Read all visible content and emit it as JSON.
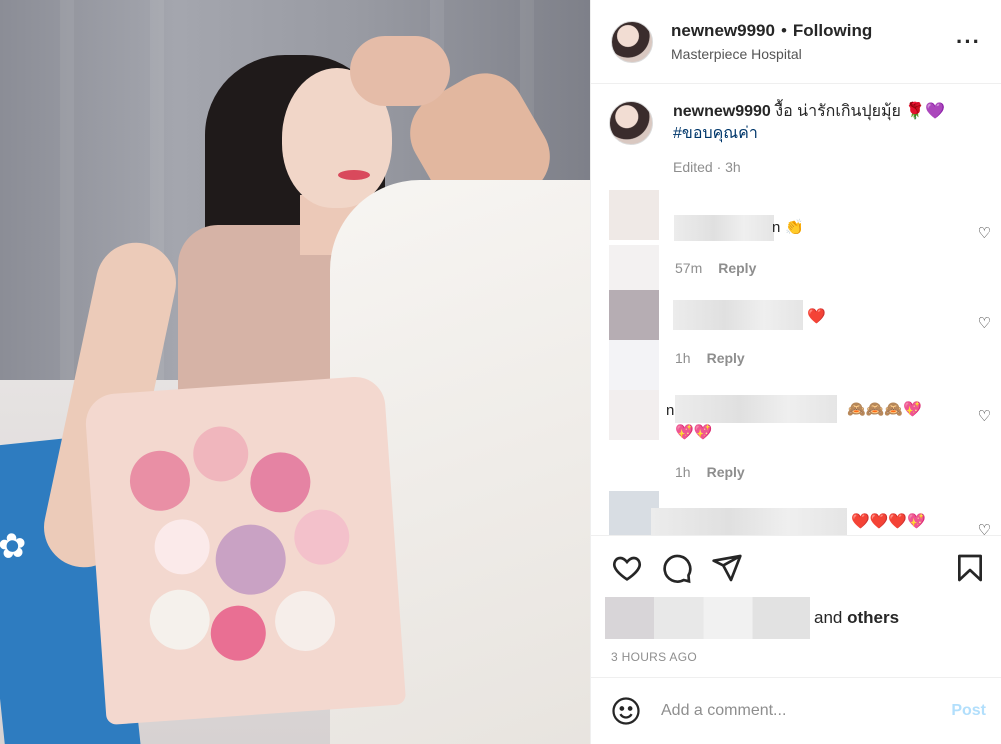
{
  "header": {
    "username": "newnew9990",
    "separator": "•",
    "follow_status": "Following",
    "location": "Masterpiece Hospital",
    "more_icon": "more-horizontal-icon"
  },
  "caption": {
    "username": "newnew9990",
    "text": "งื้อ น่ารักเกินปุยมุ้ย 🌹💜",
    "hashtag": "#ขอบคุณค่า",
    "edited": "Edited · 3h"
  },
  "comments": [
    {
      "text_suffix": "n",
      "emoji": "👏",
      "age": "57m",
      "reply": "Reply"
    },
    {
      "text_suffix": "",
      "emoji": "❤️",
      "age": "1h",
      "reply": "Reply"
    },
    {
      "text_prefix": "n",
      "emoji": "🙈🙈🙈💖",
      "emoji_line2": "💖💖",
      "age": "1h",
      "reply": "Reply"
    },
    {
      "emoji": "❤️❤️❤️💖"
    }
  ],
  "actions": {
    "like_icon": "heart-icon",
    "comment_icon": "comment-icon",
    "share_icon": "send-icon",
    "save_icon": "bookmark-icon"
  },
  "likes": {
    "and": "and",
    "others": "others"
  },
  "timestamp": "3 HOURS AGO",
  "add_comment": {
    "placeholder": "Add a comment...",
    "post_label": "Post",
    "emoji_icon": "smile-icon"
  },
  "colors": {
    "link": "#00376b",
    "post_disabled": "#b2dffc",
    "muted": "#8e8e8e"
  }
}
